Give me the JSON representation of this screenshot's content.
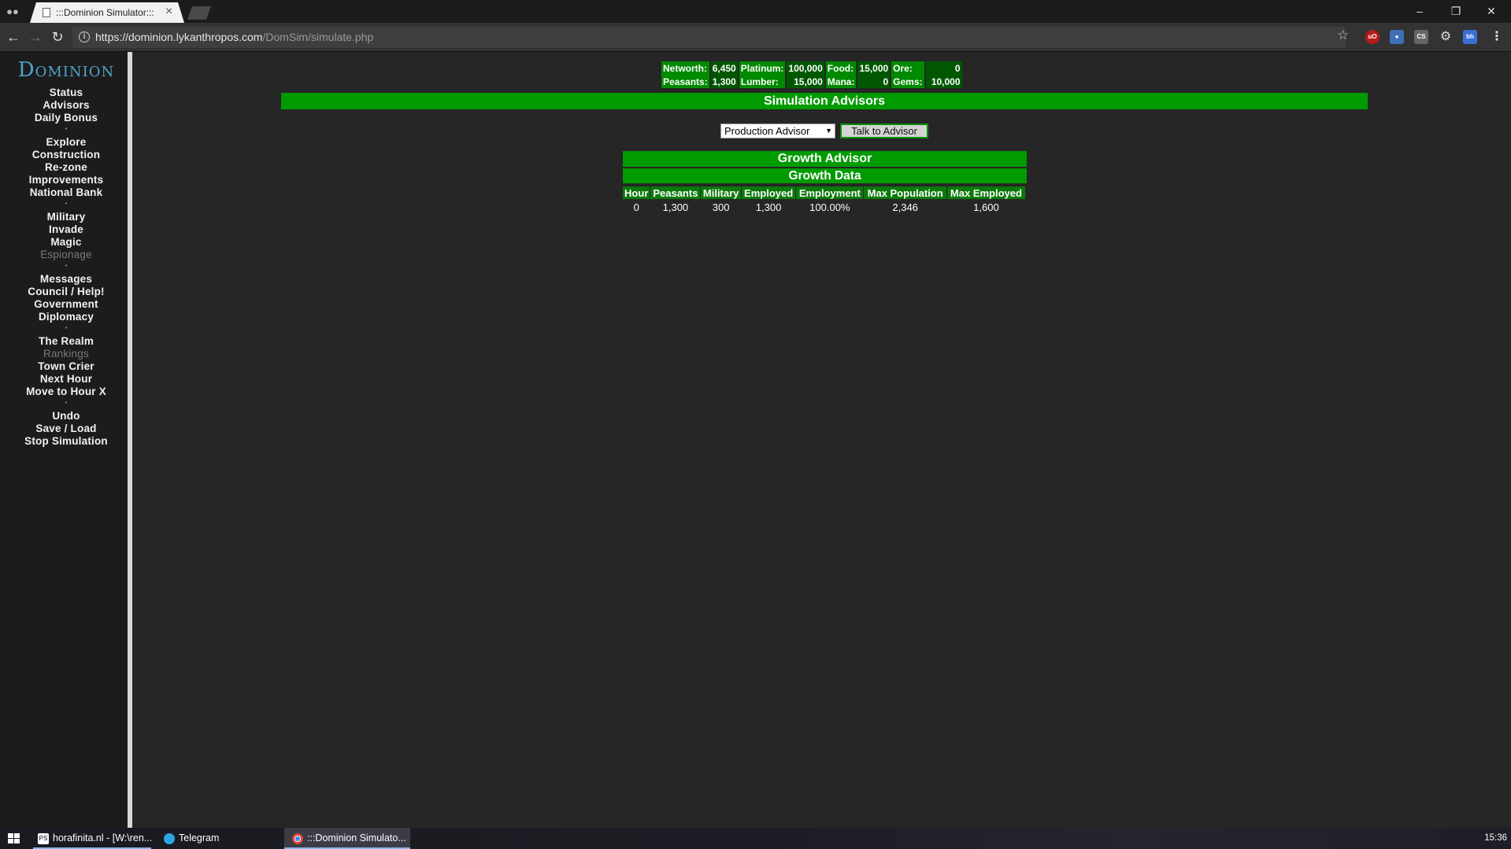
{
  "browser": {
    "tab_title": ":::Dominion Simulator:::",
    "url_host": "https://dominion.lykanthropos.com",
    "url_path": "/DomSim/simulate.php"
  },
  "sidebar": {
    "logo": "Dominion",
    "groups": [
      {
        "items": [
          {
            "label": "Status"
          },
          {
            "label": "Advisors"
          },
          {
            "label": "Daily Bonus"
          }
        ]
      },
      {
        "items": [
          {
            "label": "Explore"
          },
          {
            "label": "Construction"
          },
          {
            "label": "Re-zone"
          },
          {
            "label": "Improvements"
          },
          {
            "label": "National Bank"
          }
        ]
      },
      {
        "items": [
          {
            "label": "Military"
          },
          {
            "label": "Invade"
          },
          {
            "label": "Magic"
          },
          {
            "label": "Espionage",
            "disabled": true
          }
        ]
      },
      {
        "items": [
          {
            "label": "Messages"
          },
          {
            "label": "Council / Help!"
          },
          {
            "label": "Government"
          },
          {
            "label": "Diplomacy"
          }
        ]
      },
      {
        "items": [
          {
            "label": "The Realm"
          },
          {
            "label": "Rankings",
            "disabled": true
          },
          {
            "label": "Town Crier"
          },
          {
            "label": "Next Hour"
          },
          {
            "label": "Move to Hour X"
          }
        ]
      },
      {
        "items": [
          {
            "label": "Undo"
          },
          {
            "label": "Save / Load"
          },
          {
            "label": "Stop Simulation"
          }
        ]
      }
    ]
  },
  "resources": {
    "networth": {
      "label": "Networth:",
      "value": "6,450"
    },
    "platinum": {
      "label": "Platinum:",
      "value": "100,000"
    },
    "food": {
      "label": "Food:",
      "value": "15,000"
    },
    "ore": {
      "label": "Ore:",
      "value": "0"
    },
    "peasants": {
      "label": "Peasants:",
      "value": "1,300"
    },
    "lumber": {
      "label": "Lumber:",
      "value": "15,000"
    },
    "mana": {
      "label": "Mana:",
      "value": "0"
    },
    "gems": {
      "label": "Gems:",
      "value": "10,000"
    }
  },
  "main": {
    "header": "Simulation Advisors",
    "advisor_select_value": "Production Advisor",
    "talk_button": "Talk to Advisor",
    "growth": {
      "title": "Growth Advisor",
      "subtitle": "Growth Data",
      "columns": [
        "Hour",
        "Peasants",
        "Military",
        "Employed",
        "Employment",
        "Max Population",
        "Max Employed"
      ],
      "rows": [
        [
          "0",
          "1,300",
          "300",
          "1,300",
          "100.00%",
          "2,346",
          "1,600"
        ]
      ]
    }
  },
  "taskbar": {
    "items": [
      {
        "label": "horafinita.nl - [W:\\ren...",
        "icon": "powershell-icon"
      },
      {
        "label": "Telegram",
        "icon": "telegram-icon"
      },
      {
        "label": ":::Dominion Simulato...",
        "icon": "chrome-icon"
      }
    ],
    "clock": "15:36"
  },
  "colors": {
    "green_header": "#009b00",
    "green_label": "#008a00",
    "green_value": "#005700",
    "page_bg": "#262626",
    "sidebar_bg": "#1c1c1c",
    "logo_blue": "#4fa3c8"
  }
}
